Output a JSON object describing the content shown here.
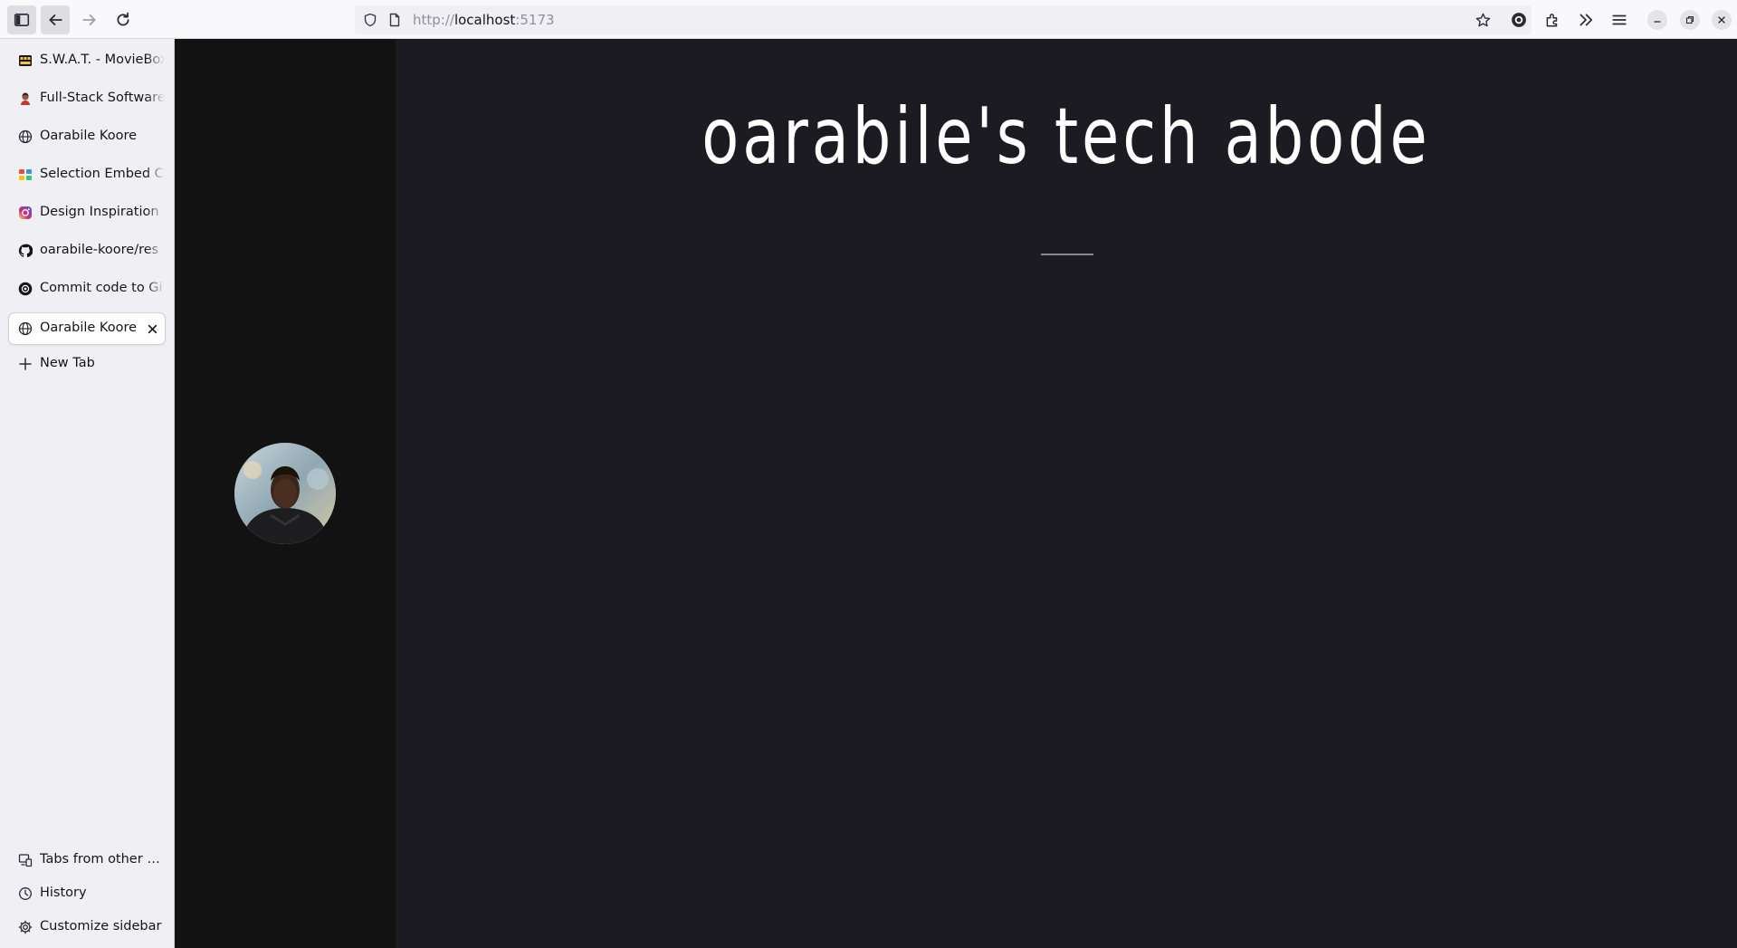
{
  "browser": {
    "url_prefix": "http://",
    "url_host": "localhost",
    "url_suffix": ":5173"
  },
  "sidebar": {
    "tabs": [
      {
        "label": "S.W.A.T. - MovieBox",
        "icon": "moviebox-favicon",
        "selected": false
      },
      {
        "label": "Full-Stack Software",
        "icon": "avatar-favicon",
        "selected": false
      },
      {
        "label": "Oarabile Koore",
        "icon": "globe-icon",
        "selected": false
      },
      {
        "label": "Selection Embed C",
        "icon": "selection-favicon",
        "selected": false
      },
      {
        "label": "Design Inspiration",
        "icon": "instagram-icon",
        "selected": false
      },
      {
        "label": "oarabile-koore/res",
        "icon": "github-icon",
        "selected": false
      },
      {
        "label": "Commit code to Gi",
        "icon": "openai-icon",
        "selected": false
      },
      {
        "label": "Oarabile Koore",
        "icon": "globe-icon",
        "selected": true
      }
    ],
    "new_tab_label": "New Tab",
    "footer": {
      "tabs_other_devices": "Tabs from other devices",
      "history": "History",
      "customize": "Customize sidebar"
    }
  },
  "page": {
    "title": "oarabile's tech abode",
    "colors": {
      "background": "#1c1b21",
      "left_panel": "#121212",
      "title": "#ffffff"
    }
  }
}
